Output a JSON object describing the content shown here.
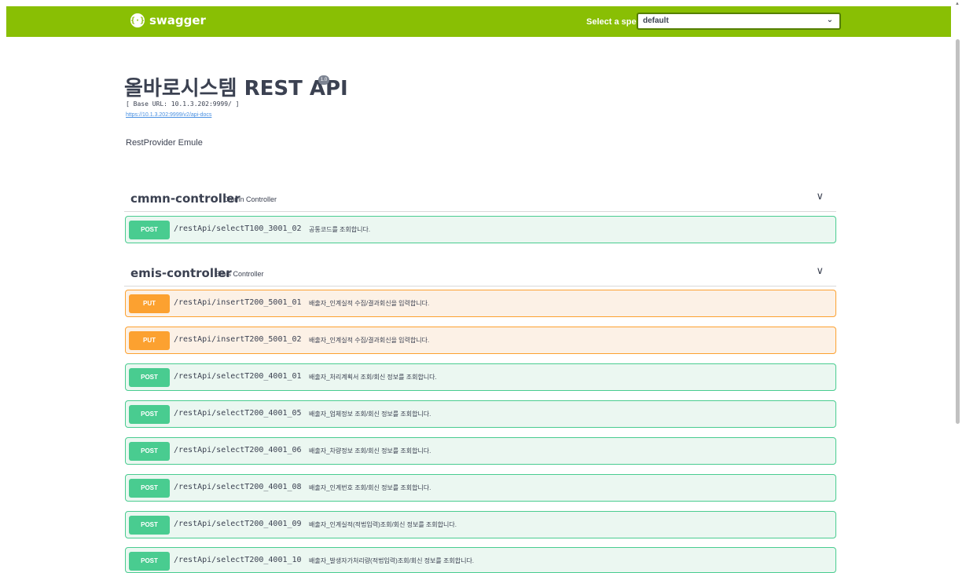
{
  "topbar": {
    "brand_text": "swagger",
    "spec_label": "Select a spec",
    "spec_value": "default"
  },
  "info": {
    "title": "올바로시스템 REST API",
    "version": "1.0",
    "base_url": "[ Base URL: 10.1.3.202:9999/ ]",
    "api_docs_link": "https://10.1.3.202:9999/v2/api-docs",
    "description": "RestProvider Emule"
  },
  "tags": [
    {
      "name": "cmmn-controller",
      "description": "Cmmn Controller",
      "operations": [
        {
          "method": "POST",
          "path": "/restApi/selectT100_3001_02",
          "summary": "공통코드를 조회합니다."
        }
      ]
    },
    {
      "name": "emis-controller",
      "description": "Emis Controller",
      "operations": [
        {
          "method": "PUT",
          "path": "/restApi/insertT200_5001_01",
          "summary": "배출자_인계실적 수집/결과회신을 입력합니다."
        },
        {
          "method": "PUT",
          "path": "/restApi/insertT200_5001_02",
          "summary": "배출자_인계실적 수집/결과회신을 입력합니다."
        },
        {
          "method": "POST",
          "path": "/restApi/selectT200_4001_01",
          "summary": "배출자_처리계획서 조회/회신 정보를 조회합니다."
        },
        {
          "method": "POST",
          "path": "/restApi/selectT200_4001_05",
          "summary": "배출자_업체정보 조회/회신 정보를 조회합니다."
        },
        {
          "method": "POST",
          "path": "/restApi/selectT200_4001_06",
          "summary": "배출자_차량정보 조회/회신 정보를 조회합니다."
        },
        {
          "method": "POST",
          "path": "/restApi/selectT200_4001_08",
          "summary": "배출자_인계번호 조회/회신 정보를 조회합니다."
        },
        {
          "method": "POST",
          "path": "/restApi/selectT200_4001_09",
          "summary": "배출자_인계실적(적법입력)조회/회신 정보를 조회합니다."
        },
        {
          "method": "POST",
          "path": "/restApi/selectT200_4001_10",
          "summary": "배출자_발생자가처리량(적법입력)조회/회신 정보를 조회합니다."
        }
      ]
    }
  ],
  "colors": {
    "topbar": "#89bf04",
    "post": "#49cc90",
    "put": "#fca130"
  }
}
